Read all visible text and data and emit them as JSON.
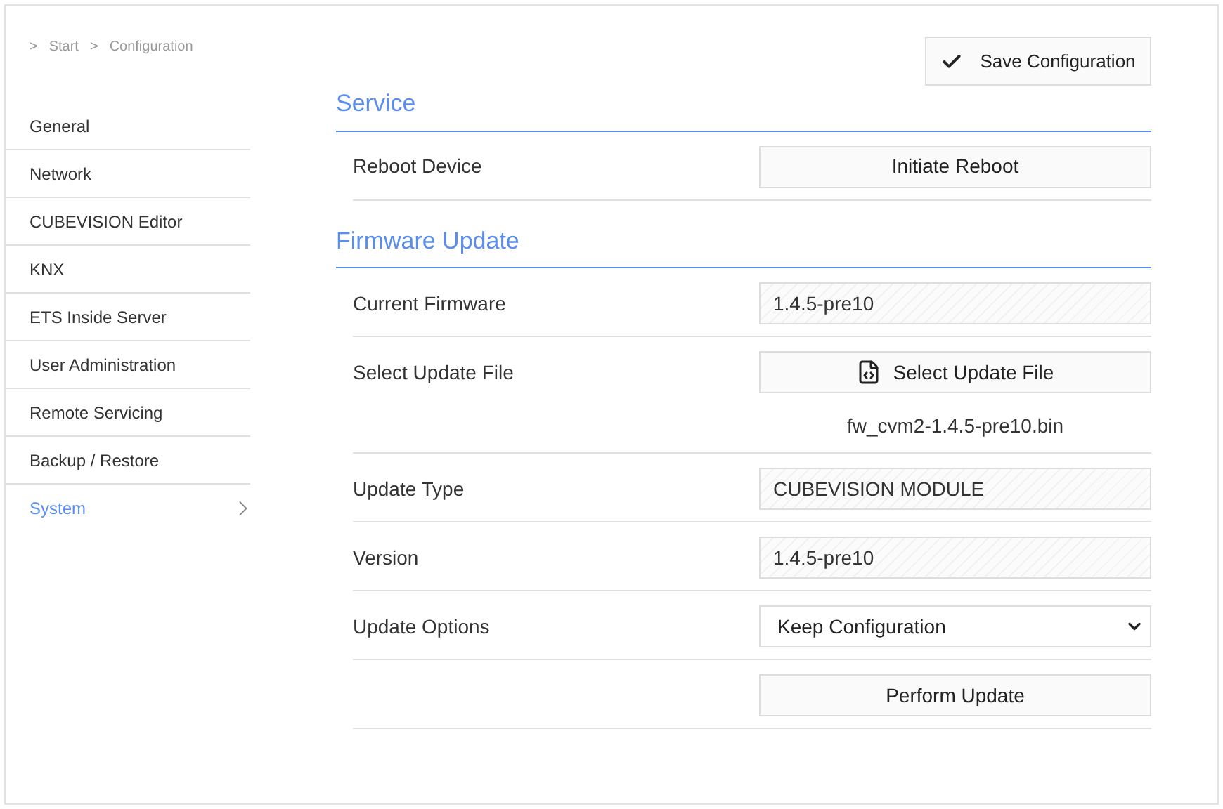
{
  "breadcrumb": [
    {
      "separator": ">",
      "label": "Start"
    },
    {
      "separator": ">",
      "label": "Configuration"
    }
  ],
  "sidebar": {
    "items": [
      {
        "label": "General",
        "selected": false
      },
      {
        "label": "Network",
        "selected": false
      },
      {
        "label": "CUBEVISION Editor",
        "selected": false
      },
      {
        "label": "KNX",
        "selected": false
      },
      {
        "label": "ETS Inside Server",
        "selected": false
      },
      {
        "label": "User Administration",
        "selected": false
      },
      {
        "label": "Remote Servicing",
        "selected": false
      },
      {
        "label": "Backup / Restore",
        "selected": false
      },
      {
        "label": "System",
        "selected": true
      }
    ]
  },
  "save_button": {
    "label": "Save Configuration"
  },
  "sections": [
    {
      "title": "Service",
      "rows": [
        {
          "kind": "button",
          "label": "Reboot Device",
          "button": "Initiate Reboot"
        }
      ]
    },
    {
      "title": "Firmware Update",
      "rows": [
        {
          "kind": "readonly",
          "label": "Current Firmware",
          "value": "1.4.5-pre10"
        },
        {
          "kind": "file",
          "label": "Select Update File",
          "button": "Select Update File",
          "file_name": "fw_cvm2-1.4.5-pre10.bin"
        },
        {
          "kind": "readonly",
          "label": "Update Type",
          "value": "CUBEVISION MODULE"
        },
        {
          "kind": "readonly",
          "label": "Version",
          "value": "1.4.5-pre10"
        },
        {
          "kind": "select",
          "label": "Update Options",
          "value": "Keep Configuration"
        },
        {
          "kind": "button",
          "button": "Perform Update"
        }
      ]
    }
  ]
}
